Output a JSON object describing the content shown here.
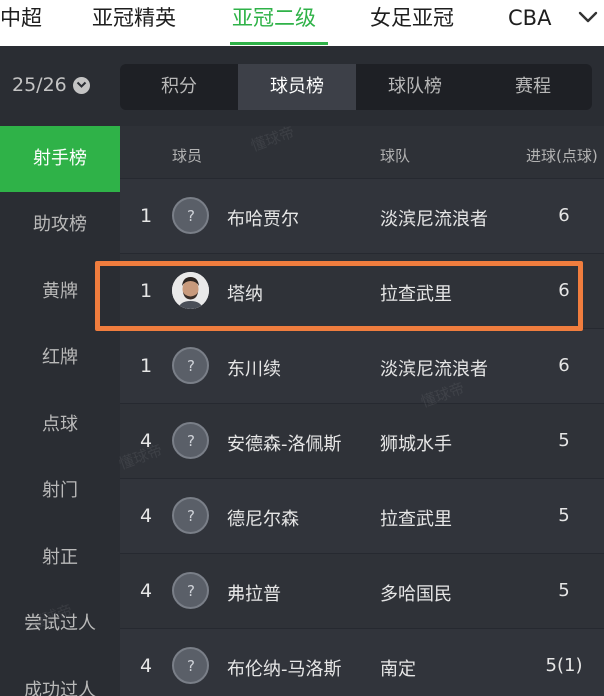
{
  "leagues": {
    "tabs": [
      "中超",
      "亚冠精英",
      "亚冠二级",
      "女足亚冠",
      "CBA"
    ],
    "active_index": 2,
    "accent": "#2fb248"
  },
  "season": {
    "label": "25/26"
  },
  "subtabs": {
    "items": [
      "积分",
      "球员榜",
      "球队榜",
      "赛程"
    ],
    "active_index": 1
  },
  "sidebar": {
    "items": [
      "射手榜",
      "助攻榜",
      "黄牌",
      "红牌",
      "点球",
      "射门",
      "射正",
      "尝试过人",
      "成功过人"
    ],
    "active_index": 0
  },
  "table": {
    "headers": {
      "player": "球员",
      "team": "球队",
      "goals": "进球(点球)"
    },
    "rows": [
      {
        "rank": "1",
        "name": "布哈贾尔",
        "team": "淡滨尼流浪者",
        "goals": "6",
        "avatar": "placeholder"
      },
      {
        "rank": "1",
        "name": "塔纳",
        "team": "拉查武里",
        "goals": "6",
        "avatar": "photo"
      },
      {
        "rank": "1",
        "name": "东川续",
        "team": "淡滨尼流浪者",
        "goals": "6",
        "avatar": "placeholder"
      },
      {
        "rank": "4",
        "name": "安德森-洛佩斯",
        "team": "狮城水手",
        "goals": "5",
        "avatar": "placeholder"
      },
      {
        "rank": "4",
        "name": "德尼尔森",
        "team": "拉查武里",
        "goals": "5",
        "avatar": "placeholder"
      },
      {
        "rank": "4",
        "name": "弗拉普",
        "team": "多哈国民",
        "goals": "5",
        "avatar": "placeholder"
      },
      {
        "rank": "4",
        "name": "布伦纳-马洛斯",
        "team": "南定",
        "goals": "5(1)",
        "avatar": "placeholder"
      }
    ],
    "highlight_color": "#f07d3e"
  },
  "watermark": "懂球帝"
}
